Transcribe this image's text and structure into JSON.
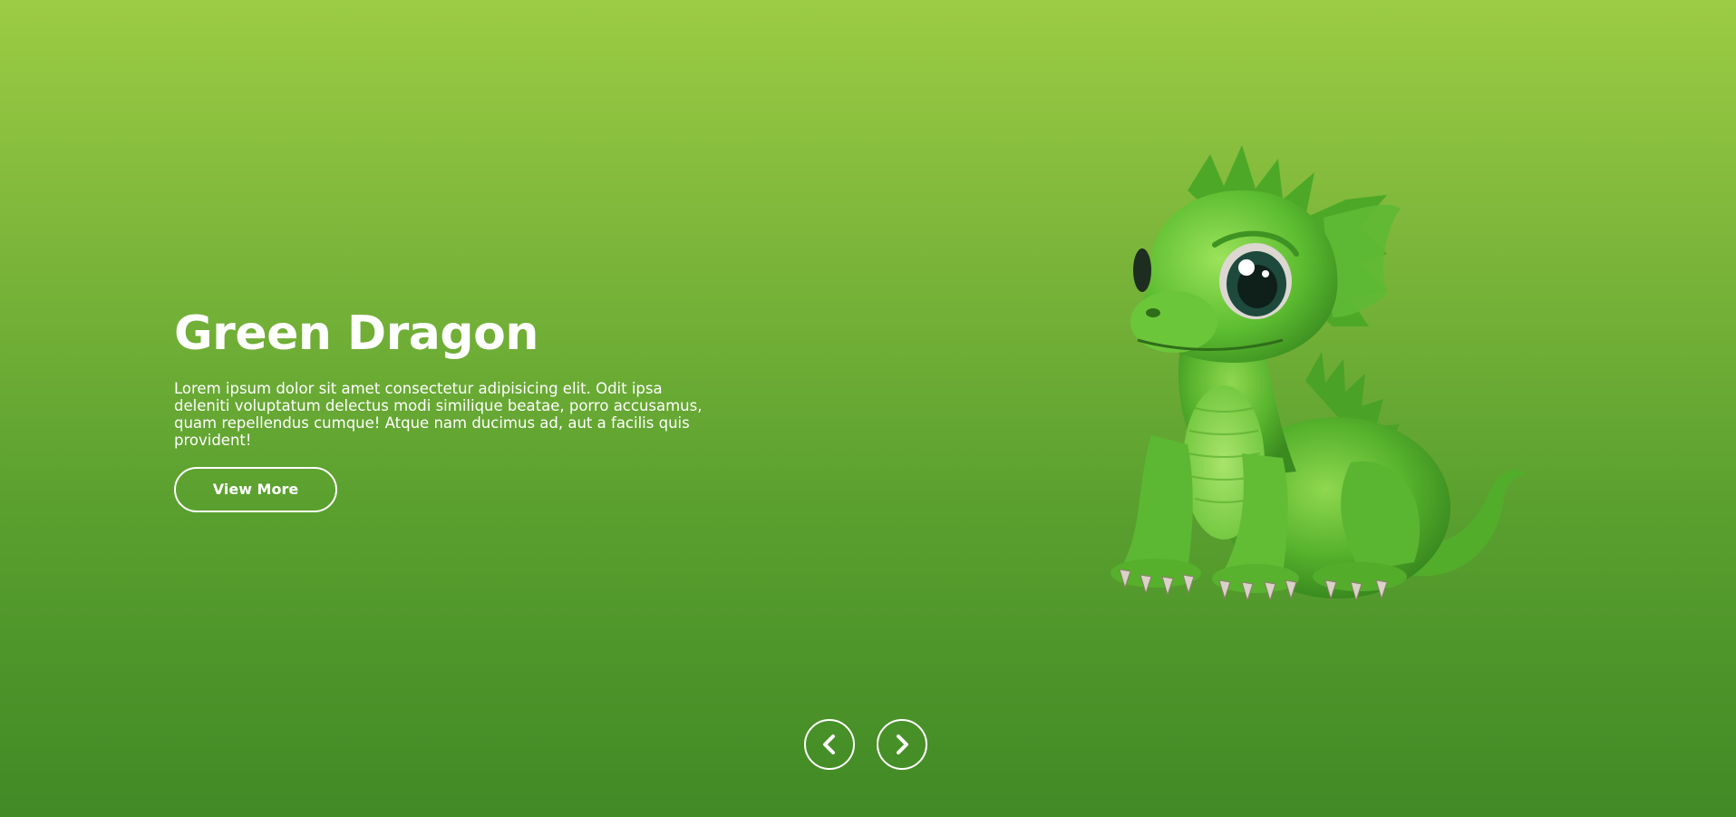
{
  "slide": {
    "title": "Green Dragon",
    "description": "Lorem ipsum dolor sit amet consectetur adipisicing elit. Odit ipsa deleniti voluptatum delectus modi similique beatae, porro accusamus, quam repellendus cumque! Atque nam ducimus ad, aut a facilis quis provident!",
    "button_label": "View More",
    "image_icon": "green-dragon-illustration"
  },
  "navigation": {
    "prev_icon": "chevron-left-icon",
    "next_icon": "chevron-right-icon"
  },
  "colors": {
    "background_top": "#9ccc44",
    "background_bottom": "#418a25",
    "text": "#ffffff",
    "dragon_green": "#5cb82f"
  }
}
